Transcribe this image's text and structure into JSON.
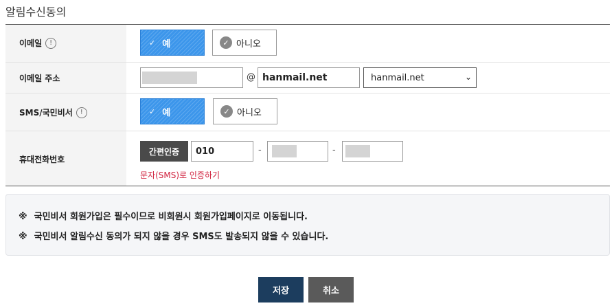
{
  "title": "알림수신동의",
  "rows": {
    "email_consent": {
      "label": "이메일",
      "info_icon": "!",
      "yes_label": "예",
      "no_label": "아니오"
    },
    "email_address": {
      "label": "이메일 주소",
      "at_sign": "@",
      "domain_value": "hanmail.net",
      "domain_select": "hanmail.net"
    },
    "sms_consent": {
      "label": "SMS/국민비서",
      "info_icon": "!",
      "yes_label": "예",
      "no_label": "아니오"
    },
    "phone": {
      "label": "휴대전화번호",
      "verify_button": "간편인증",
      "prefix_value": "010",
      "dash": "-",
      "sms_link": "문자(SMS)로 인증하기"
    }
  },
  "notice": {
    "mark": "※",
    "line1": "국민비서 회원가입은 필수이므로 비회원시 회원가입페이지로 이동됩니다.",
    "line2": "국민비서 알림수신 동의가 되지 않을 경우 SMS도 발송되지 않을 수 있습니다."
  },
  "buttons": {
    "save": "저장",
    "cancel": "취소"
  },
  "icons": {
    "check": "check-icon",
    "info": "info-icon",
    "chevron": "chevron-down-icon"
  },
  "colors": {
    "yes_button": "#3c96eb",
    "save_button": "#1c3d5e",
    "cancel_button": "#5a5a5a",
    "sms_link": "#d0213d"
  }
}
